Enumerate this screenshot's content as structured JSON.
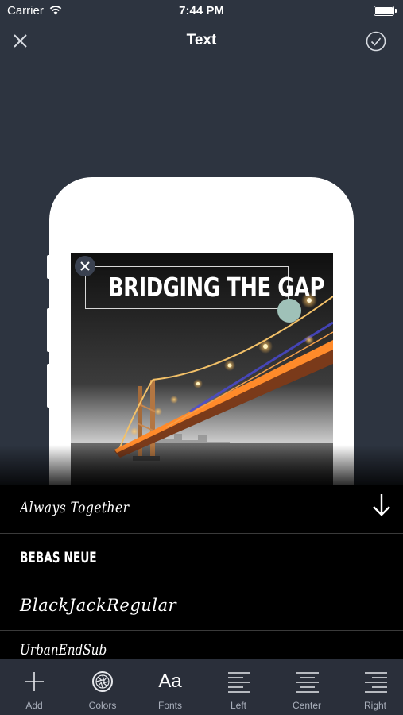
{
  "status_bar": {
    "carrier": "Carrier",
    "time": "7:44 PM"
  },
  "nav": {
    "title": "Text"
  },
  "canvas": {
    "headline": "BRIDGING THE GAP"
  },
  "font_list": {
    "items": [
      {
        "label": "Always Together"
      },
      {
        "label": "BEBAS NEUE"
      },
      {
        "label": "BlackJackRegular"
      },
      {
        "label": "UrbanEndSub"
      }
    ]
  },
  "toolbar": {
    "items": [
      {
        "label": "Add",
        "icon": "plus-icon"
      },
      {
        "label": "Colors",
        "icon": "color-wheel-icon"
      },
      {
        "label": "Fonts",
        "icon": "font-aa-icon",
        "glyph": "Aa",
        "active": true
      },
      {
        "label": "Left",
        "icon": "align-left-icon"
      },
      {
        "label": "Center",
        "icon": "align-center-icon"
      },
      {
        "label": "Right",
        "icon": "align-right-icon"
      }
    ]
  },
  "colors": {
    "background": "#2d3440",
    "panel": "#000000",
    "toolbar": "#2a2f3a",
    "handle_accent": "#9fc1b8"
  }
}
